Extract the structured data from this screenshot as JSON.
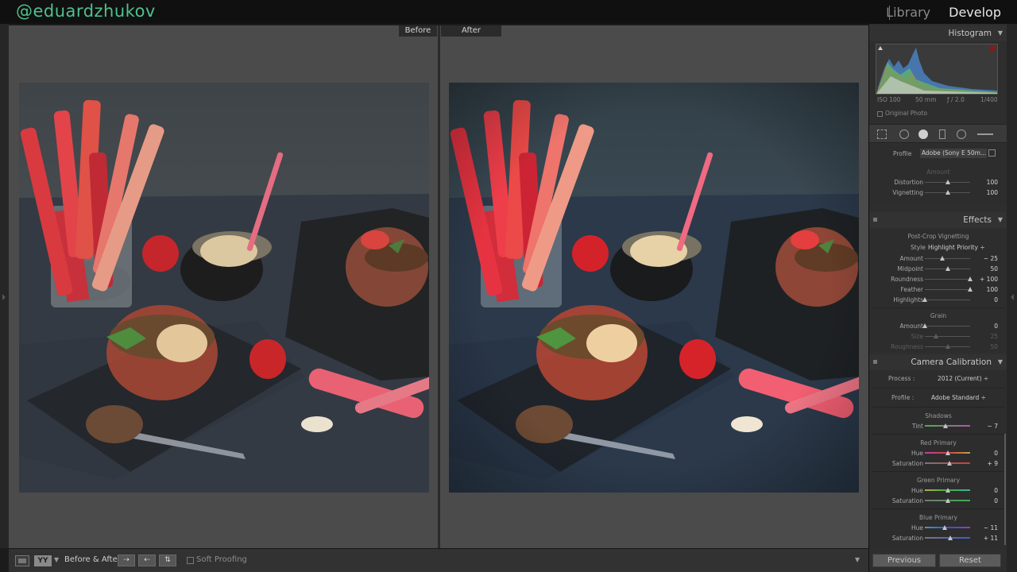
{
  "watermark": "@eduardzhukov",
  "modules": {
    "library": "Library",
    "develop": "Develop"
  },
  "view_tabs": {
    "before": "Before",
    "after": "After"
  },
  "toolbar": {
    "view_mode": "YY",
    "before_after_label": "Before & After :",
    "soft_proofing_label": "Soft Proofing"
  },
  "histogram": {
    "title": "Histogram",
    "iso": "ISO 100",
    "focal": "50 mm",
    "aperture": "ƒ / 2.0",
    "shutter": "1/400",
    "original_photo_label": "Original Photo"
  },
  "lens_corrections": {
    "profile_label": "Profile",
    "profile_value": "Adobe (Sony E 50m...",
    "amount_label": "Amount",
    "sliders": [
      {
        "label": "Distortion",
        "value": "100",
        "level": 0.5
      },
      {
        "label": "Vignetting",
        "value": "100",
        "level": 0.5
      }
    ]
  },
  "effects": {
    "title": "Effects",
    "post_crop_title": "Post-Crop Vignetting",
    "style_label": "Style",
    "style_value": "Highlight Priority",
    "vignette_sliders": [
      {
        "label": "Amount",
        "value": "− 25",
        "level": 0.38
      },
      {
        "label": "Midpoint",
        "value": "50",
        "level": 0.5
      },
      {
        "label": "Roundness",
        "value": "+ 100",
        "level": 1.0
      },
      {
        "label": "Feather",
        "value": "100",
        "level": 1.0
      },
      {
        "label": "Highlights",
        "value": "0",
        "level": 0.0
      }
    ],
    "grain_title": "Grain",
    "grain_sliders": [
      {
        "label": "Amount",
        "value": "0",
        "level": 0.0
      },
      {
        "label": "Size",
        "value": "25",
        "level": 0.25
      },
      {
        "label": "Roughness",
        "value": "50",
        "level": 0.5
      }
    ]
  },
  "camera_calibration": {
    "title": "Camera Calibration",
    "process_label": "Process :",
    "process_value": "2012 (Current)",
    "profile_label": "Profile :",
    "profile_value": "Adobe Standard",
    "shadows": {
      "title": "Shadows",
      "tint": {
        "label": "Tint",
        "value": "− 7",
        "level": 0.46
      }
    },
    "red_primary": {
      "title": "Red Primary",
      "hue": {
        "label": "Hue",
        "value": "0",
        "level": 0.5
      },
      "saturation": {
        "label": "Saturation",
        "value": "+ 9",
        "level": 0.55
      }
    },
    "green_primary": {
      "title": "Green Primary",
      "hue": {
        "label": "Hue",
        "value": "0",
        "level": 0.5
      },
      "saturation": {
        "label": "Saturation",
        "value": "0",
        "level": 0.5
      }
    },
    "blue_primary": {
      "title": "Blue Primary",
      "hue": {
        "label": "Hue",
        "value": "− 11",
        "level": 0.44
      },
      "saturation": {
        "label": "Saturation",
        "value": "+ 11",
        "level": 0.56
      }
    }
  },
  "buttons": {
    "previous": "Previous",
    "reset": "Reset"
  }
}
